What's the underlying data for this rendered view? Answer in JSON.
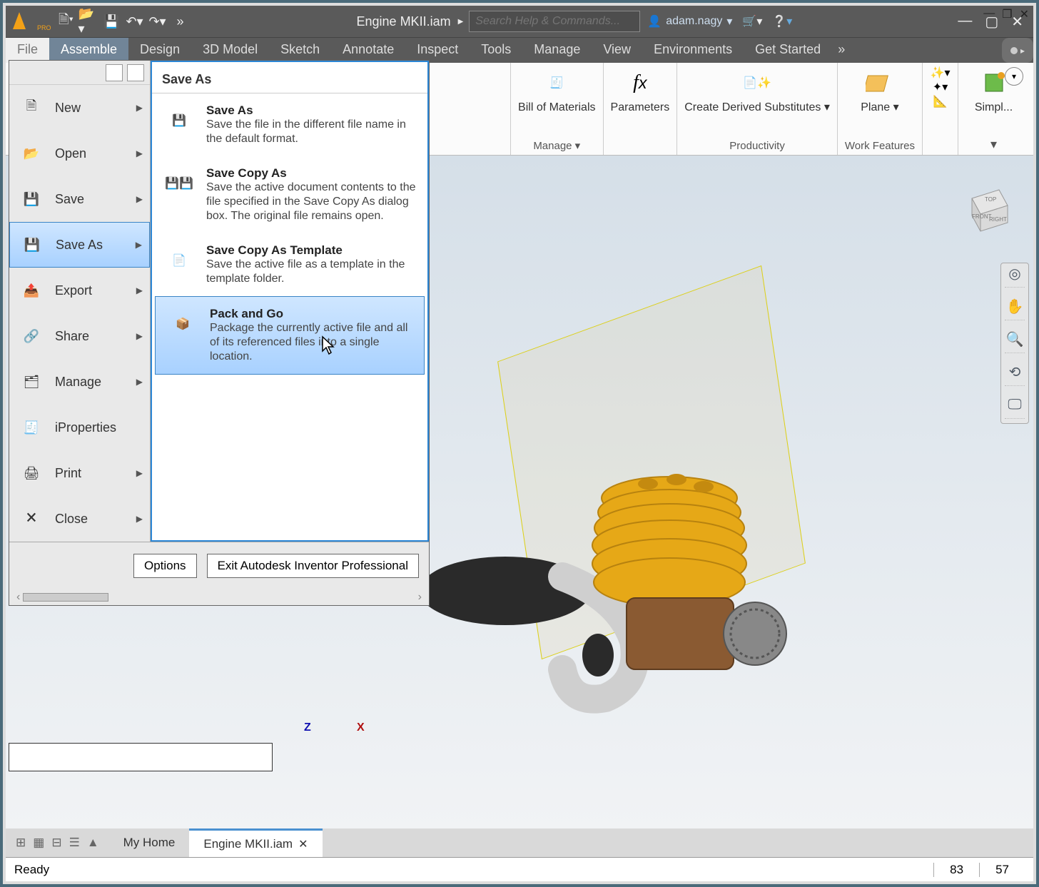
{
  "titlebar": {
    "logo_text": "PRO",
    "doc_title": "Engine MKII.iam",
    "search_placeholder": "Search Help & Commands...",
    "user": "adam.nagy"
  },
  "ribbon_tabs": [
    "File",
    "Assemble",
    "Design",
    "3D Model",
    "Sketch",
    "Annotate",
    "Inspect",
    "Tools",
    "Manage",
    "View",
    "Environments",
    "Get Started"
  ],
  "ribbon_groups": {
    "bom": {
      "label": "Bill of Materials",
      "caption": "Manage ▾"
    },
    "params": {
      "label": "Parameters"
    },
    "derived": {
      "label": "Create Derived Substitutes ▾",
      "caption": "Productivity"
    },
    "plane": {
      "label": "Plane ▾",
      "caption": "Work Features"
    },
    "simpl": {
      "label": "Simpl..."
    }
  },
  "file_menu": {
    "header": "Save As",
    "items": [
      {
        "label": "New",
        "arrow": true
      },
      {
        "label": "Open",
        "arrow": true
      },
      {
        "label": "Save",
        "arrow": true
      },
      {
        "label": "Save As",
        "arrow": true,
        "active": true
      },
      {
        "label": "Export",
        "arrow": true
      },
      {
        "label": "Share",
        "arrow": true
      },
      {
        "label": "Manage",
        "arrow": true
      },
      {
        "label": "iProperties",
        "arrow": false
      },
      {
        "label": "Print",
        "arrow": true
      },
      {
        "label": "Close",
        "arrow": true
      }
    ],
    "subs": [
      {
        "title": "Save As",
        "desc": "Save the file in the different file name in the default format."
      },
      {
        "title": "Save Copy As",
        "desc": "Save the active document contents to the file specified in the Save Copy As dialog box. The original file remains open."
      },
      {
        "title": "Save Copy As Template",
        "desc": "Save the active file as a template in the template folder."
      },
      {
        "title": "Pack and Go",
        "desc": "Package the currently active file and all of its referenced files into a single location.",
        "hover": true
      }
    ],
    "options_btn": "Options",
    "exit_btn": "Exit Autodesk Inventor Professional"
  },
  "viewcube": {
    "front": "FRONT",
    "right": "RIGHT",
    "top": "TOP"
  },
  "axes": {
    "z": "Z",
    "x": "X"
  },
  "doctabs": {
    "home": "My Home",
    "active": "Engine MKII.iam"
  },
  "status": {
    "ready": "Ready",
    "num1": "83",
    "num2": "57"
  }
}
